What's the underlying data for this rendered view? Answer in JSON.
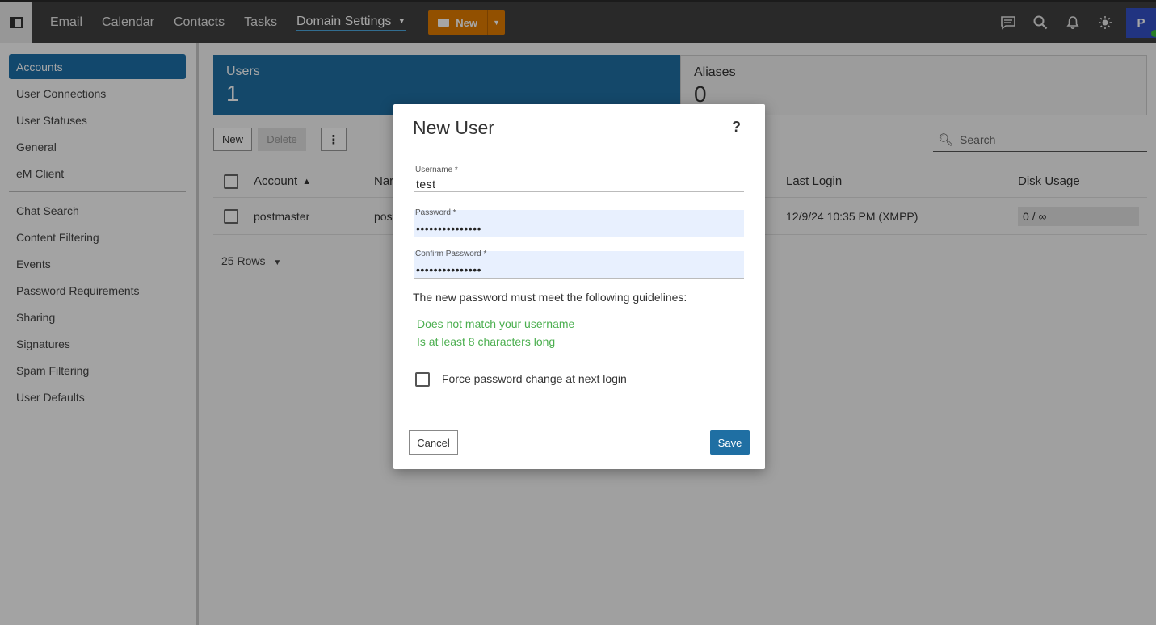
{
  "topbar": {
    "nav": [
      "Email",
      "Calendar",
      "Contacts",
      "Tasks"
    ],
    "active_nav": "Domain Settings",
    "new_label": "New",
    "avatar_letter": "P"
  },
  "sidebar": {
    "group1": [
      "Accounts",
      "User Connections",
      "User Statuses",
      "General",
      "eM Client"
    ],
    "group2": [
      "Chat Search",
      "Content Filtering",
      "Events",
      "Password Requirements",
      "Sharing",
      "Signatures",
      "Spam Filtering",
      "User Defaults"
    ]
  },
  "tiles": {
    "users_label": "Users",
    "users_count": "1",
    "aliases_label": "Aliases",
    "aliases_count": "0"
  },
  "toolbar": {
    "new_label": "New",
    "delete_label": "Delete",
    "search_placeholder": "Search"
  },
  "grid": {
    "headers": {
      "account": "Account",
      "name": "Nar",
      "last_login": "Last Login",
      "disk_usage": "Disk Usage"
    },
    "rows": [
      {
        "account": "postmaster",
        "name": "post",
        "last_login": "12/9/24 10:35 PM (XMPP)",
        "disk_usage": "0 / ∞"
      }
    ],
    "rows_per_page": "25 Rows"
  },
  "dialog": {
    "title": "New User",
    "help": "?",
    "username_label": "Username *",
    "username_value": "test",
    "password_label": "Password *",
    "password_value": "•••••••••••••••",
    "confirm_label": "Confirm Password *",
    "confirm_value": "•••••••••••••••",
    "guideline_intro": "The new password must meet the following guidelines:",
    "guidelines": [
      "Does not match your username",
      "Is at least 8 characters long"
    ],
    "force_label": "Force password change at next login",
    "cancel_label": "Cancel",
    "save_label": "Save"
  },
  "colors": {
    "accent": "#1f6fa3",
    "new_button": "#e07b00",
    "guideline_ok": "#4caf50"
  }
}
